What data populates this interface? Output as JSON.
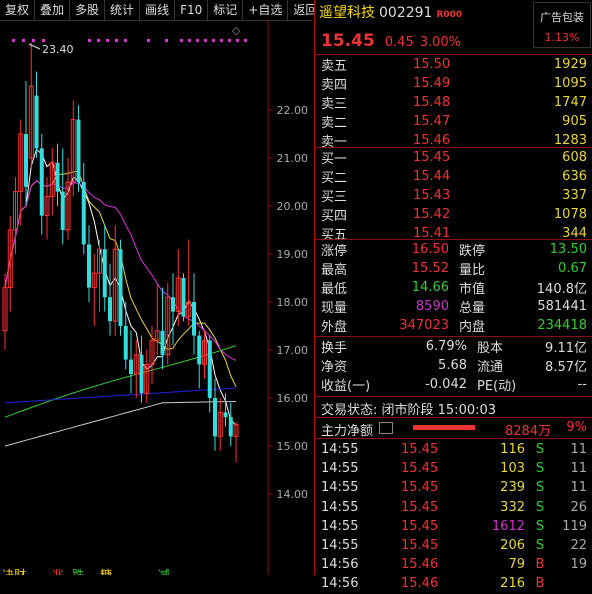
{
  "toolbar": {
    "items": [
      "复权",
      "叠加",
      "多股",
      "统计",
      "画线",
      "F10",
      "标记",
      "+自选",
      "返回"
    ]
  },
  "chart": {
    "y_labels": [
      "22.00",
      "21.00",
      "20.00",
      "19.00",
      "18.00",
      "17.00",
      "16.00",
      "15.00",
      "14.00"
    ],
    "high_label": "23.40",
    "bottom_marks": [
      "决财",
      "兆",
      "跌",
      "糖",
      "减"
    ],
    "colors": {
      "up": "#ff3333",
      "down": "#33dddd",
      "ma5": "#ffffff",
      "ma10": "#e8d53a",
      "ma20": "#dd33dd",
      "ma60": "#33cc33",
      "ma120": "#2222dd",
      "ma250": "#cccccc"
    }
  },
  "stock": {
    "name": "遥望科技",
    "code": "002291",
    "tag": "R000",
    "price": "15.45",
    "change": "0.45",
    "change_pct": "3.00%"
  },
  "ad": {
    "label": "广告包装",
    "pct": "1.13%"
  },
  "sell": [
    {
      "label": "卖五",
      "price": "15.50",
      "vol": "1929"
    },
    {
      "label": "卖四",
      "price": "15.49",
      "vol": "1095"
    },
    {
      "label": "卖三",
      "price": "15.48",
      "vol": "1747"
    },
    {
      "label": "卖二",
      "price": "15.47",
      "vol": "905"
    },
    {
      "label": "卖一",
      "price": "15.46",
      "vol": "1283"
    }
  ],
  "buy": [
    {
      "label": "买一",
      "price": "15.45",
      "vol": "608"
    },
    {
      "label": "买二",
      "price": "15.44",
      "vol": "636"
    },
    {
      "label": "买三",
      "price": "15.43",
      "vol": "337"
    },
    {
      "label": "买四",
      "price": "15.42",
      "vol": "1078"
    },
    {
      "label": "买五",
      "price": "15.41",
      "vol": "344"
    }
  ],
  "stats1": [
    {
      "l1": "涨停",
      "v1": "16.50",
      "l2": "跌停",
      "v2": "13.50"
    },
    {
      "l1": "最高",
      "v1": "15.52",
      "l2": "量比",
      "v2": "0.67"
    },
    {
      "l1": "最低",
      "v1": "14.66",
      "l2": "市值",
      "v2": "140.8亿"
    },
    {
      "l1": "现量",
      "v1": "8590",
      "l2": "总量",
      "v2": "581441"
    },
    {
      "l1": "外盘",
      "v1": "347023",
      "l2": "内盘",
      "v2": "234418"
    }
  ],
  "stats2": [
    {
      "l1": "换手",
      "v1": "6.79%",
      "l2": "股本",
      "v2": "9.11亿"
    },
    {
      "l1": "净资",
      "v1": "5.68",
      "l2": "流通",
      "v2": "8.57亿"
    },
    {
      "l1": "收益(一)",
      "v1": "-0.042",
      "l2": "PE(动)",
      "v2": "--"
    }
  ],
  "status": {
    "text": "交易状态: 闭市阶段 15:00:03"
  },
  "flow": {
    "label": "主力净额",
    "value": "8284万",
    "pct": "9%"
  },
  "ticks": [
    {
      "t": "14:55",
      "p": "15.45",
      "v": "116",
      "f": "S",
      "n": "11"
    },
    {
      "t": "14:55",
      "p": "15.45",
      "v": "103",
      "f": "S",
      "n": "11"
    },
    {
      "t": "14:55",
      "p": "15.45",
      "v": "239",
      "f": "S",
      "n": "11"
    },
    {
      "t": "14:55",
      "p": "15.45",
      "v": "332",
      "f": "S",
      "n": "26"
    },
    {
      "t": "14:55",
      "p": "15.45",
      "v": "1612",
      "f": "S",
      "n": "119"
    },
    {
      "t": "14:55",
      "p": "15.45",
      "v": "206",
      "f": "S",
      "n": "22"
    },
    {
      "t": "14:56",
      "p": "15.46",
      "v": "79",
      "f": "B",
      "n": "19"
    },
    {
      "t": "14:56",
      "p": "15.46",
      "v": "216",
      "f": "B",
      "n": ""
    }
  ]
}
